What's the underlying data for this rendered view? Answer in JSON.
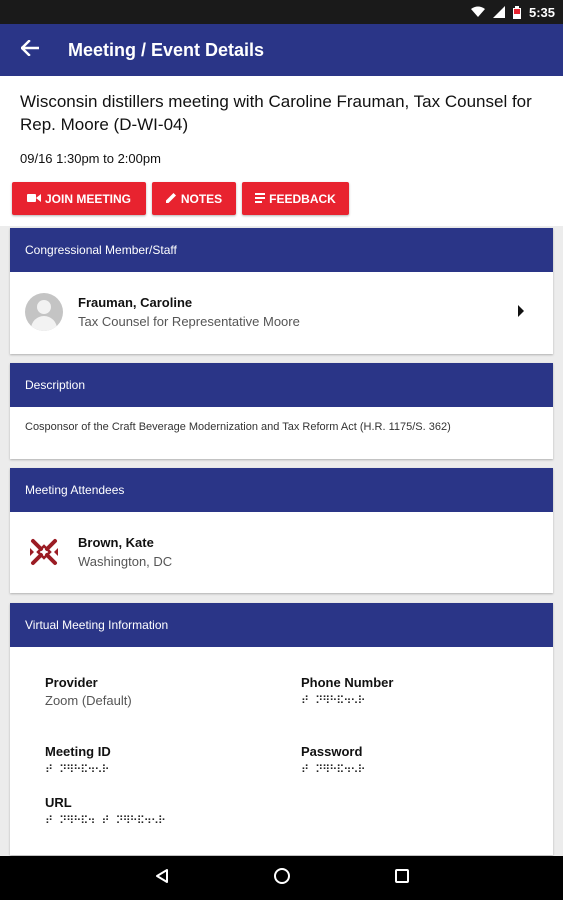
{
  "status_bar": {
    "time": "5:35"
  },
  "app_bar": {
    "title": "Meeting / Event Details"
  },
  "meeting": {
    "title": "Wisconsin distillers meeting with Caroline Frauman, Tax Counsel for Rep. Moore (D-WI-04)",
    "time": "09/16 1:30pm to 2:00pm"
  },
  "actions": {
    "join": "JOIN MEETING",
    "notes": "NOTES",
    "feedback": "FEEDBACK"
  },
  "member_card": {
    "header": "Congressional Member/Staff",
    "name": "Frauman, Caroline",
    "title": "Tax Counsel for Representative Moore"
  },
  "description_card": {
    "header": "Description",
    "text": "Cosponsor of the Craft Beverage Modernization and Tax Reform Act (H.R. 1175/S. 362)"
  },
  "attendees_card": {
    "header": "Meeting Attendees",
    "name": "Brown, Kate",
    "location": "Washington, DC"
  },
  "virtual_card": {
    "header": "Virtual Meeting Information",
    "provider_label": "Provider",
    "provider_value": "Zoom (Default)",
    "phone_label": "Phone Number",
    "phone_value": "⠞⠀⠝⠻⠓⠯⠲⠢⠗",
    "meeting_id_label": "Meeting ID",
    "meeting_id_value": "⠞⠀⠝⠻⠓⠯⠲⠢⠗",
    "password_label": "Password",
    "password_value": "⠞⠀⠝⠻⠓⠯⠲⠢⠗",
    "url_label": "URL",
    "url_value": "⠞⠀⠝⠻⠓⠯⠲⠀⠞⠀⠝⠻⠓⠯⠲⠢⠗"
  },
  "colors": {
    "primary": "#2a3587",
    "accent": "#e8232f",
    "logo": "#9b1c24"
  },
  "icons": {
    "back": "arrow-left-icon",
    "video": "video-camera-icon",
    "pencil": "pencil-icon",
    "feedback": "list-icon",
    "chevron": "chevron-right-icon"
  }
}
